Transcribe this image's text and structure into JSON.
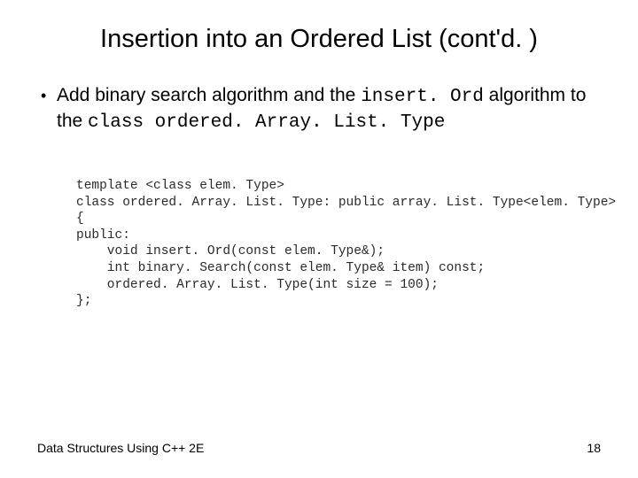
{
  "slide": {
    "title": "Insertion into an Ordered List (cont'd. )",
    "bullet": {
      "prefix": "Add binary search algorithm and the ",
      "code1": "insert. Ord",
      "mid": " algorithm to the ",
      "code2": "class ordered. Array. List. Type"
    },
    "code": {
      "l1": "template <class elem. Type>",
      "l2": "class ordered. Array. List. Type: public array. List. Type<elem. Type>",
      "l3": "{",
      "l4": "public:",
      "l5": "    void insert. Ord(const elem. Type&);",
      "l6": "    int binary. Search(const elem. Type& item) const;",
      "l7": "    ordered. Array. List. Type(int size = 100);",
      "l8": "};"
    }
  },
  "footer": {
    "left": "Data Structures Using C++ 2E",
    "right": "18"
  }
}
